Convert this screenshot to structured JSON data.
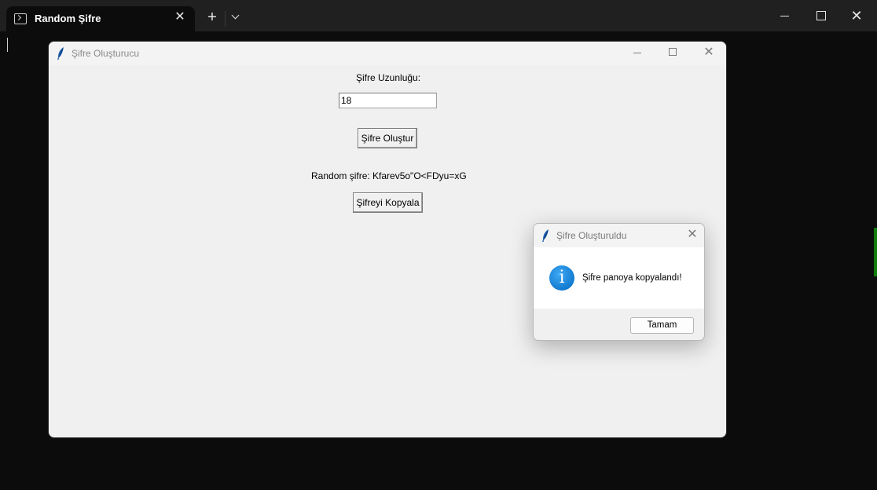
{
  "terminal": {
    "tab_title": "Random Şifre",
    "close_glyph": "✕",
    "new_tab_glyph": "+",
    "window_close_glyph": "✕"
  },
  "app": {
    "title": "Şifre Oluşturucu",
    "close_glyph": "✕",
    "length_label": "Şifre Uzunluğu:",
    "length_value": "18",
    "generate_button": "Şifre Oluştur",
    "result_text": "Random şifre: Kfarev5o\"O<FDyu=xG",
    "copy_button": "Şifreyi Kopyala"
  },
  "dialog": {
    "title": "Şifre Oluşturuldu",
    "close_glyph": "✕",
    "info_glyph": "i",
    "message": "Şifre panoya kopyalandı!",
    "ok_button": "Tamam"
  },
  "colors": {
    "terminal_bg": "#0c0c0c",
    "titlebar_bg": "#202020",
    "app_bg": "#f0f0f0",
    "info_accent": "#0067c0",
    "feather": "#1d5fb0"
  }
}
